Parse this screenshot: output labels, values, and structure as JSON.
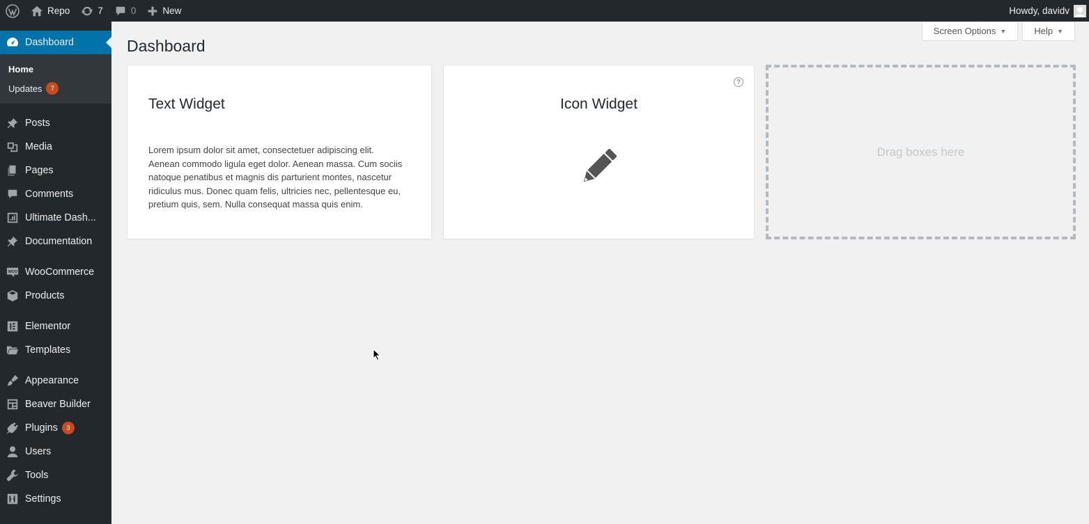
{
  "adminbar": {
    "site_name": "Repo",
    "updates_count": "7",
    "comments_count": "0",
    "new_label": "New",
    "greeting": "Howdy, davidv"
  },
  "sidebar": {
    "current": "Dashboard",
    "submenu": [
      {
        "label": "Home",
        "active": true
      },
      {
        "label": "Updates",
        "badge": "7"
      }
    ],
    "items": [
      {
        "label": "Posts",
        "icon": "pushpin-icon"
      },
      {
        "label": "Media",
        "icon": "media-icon"
      },
      {
        "label": "Pages",
        "icon": "pages-icon"
      },
      {
        "label": "Comments",
        "icon": "comment-icon"
      },
      {
        "label": "Ultimate Dash...",
        "icon": "chart-icon"
      },
      {
        "label": "Documentation",
        "icon": "pushpin-icon"
      },
      {
        "label": "WooCommerce",
        "icon": "woo-icon"
      },
      {
        "label": "Products",
        "icon": "box-icon"
      },
      {
        "label": "Elementor",
        "icon": "elementor-icon"
      },
      {
        "label": "Templates",
        "icon": "folder-icon"
      },
      {
        "label": "Appearance",
        "icon": "brush-icon"
      },
      {
        "label": "Beaver Builder",
        "icon": "layout-icon"
      },
      {
        "label": "Plugins",
        "icon": "plug-icon",
        "badge": "3"
      },
      {
        "label": "Users",
        "icon": "user-icon"
      },
      {
        "label": "Tools",
        "icon": "wrench-icon"
      },
      {
        "label": "Settings",
        "icon": "sliders-icon"
      }
    ]
  },
  "main": {
    "screen_options_label": "Screen Options",
    "help_label": "Help",
    "page_title": "Dashboard",
    "text_widget": {
      "title": "Text Widget",
      "body": "Lorem ipsum dolor sit amet, consectetuer adipiscing elit. Aenean commodo ligula eget dolor. Aenean massa. Cum sociis natoque penatibus et magnis dis parturient montes, nascetur ridiculus mus. Donec quam felis, ultricies nec, pellentesque eu, pretium quis, sem. Nulla consequat massa quis enim."
    },
    "icon_widget": {
      "title": "Icon Widget",
      "icon": "pencil-icon"
    },
    "drop_zone_label": "Drag boxes here"
  }
}
